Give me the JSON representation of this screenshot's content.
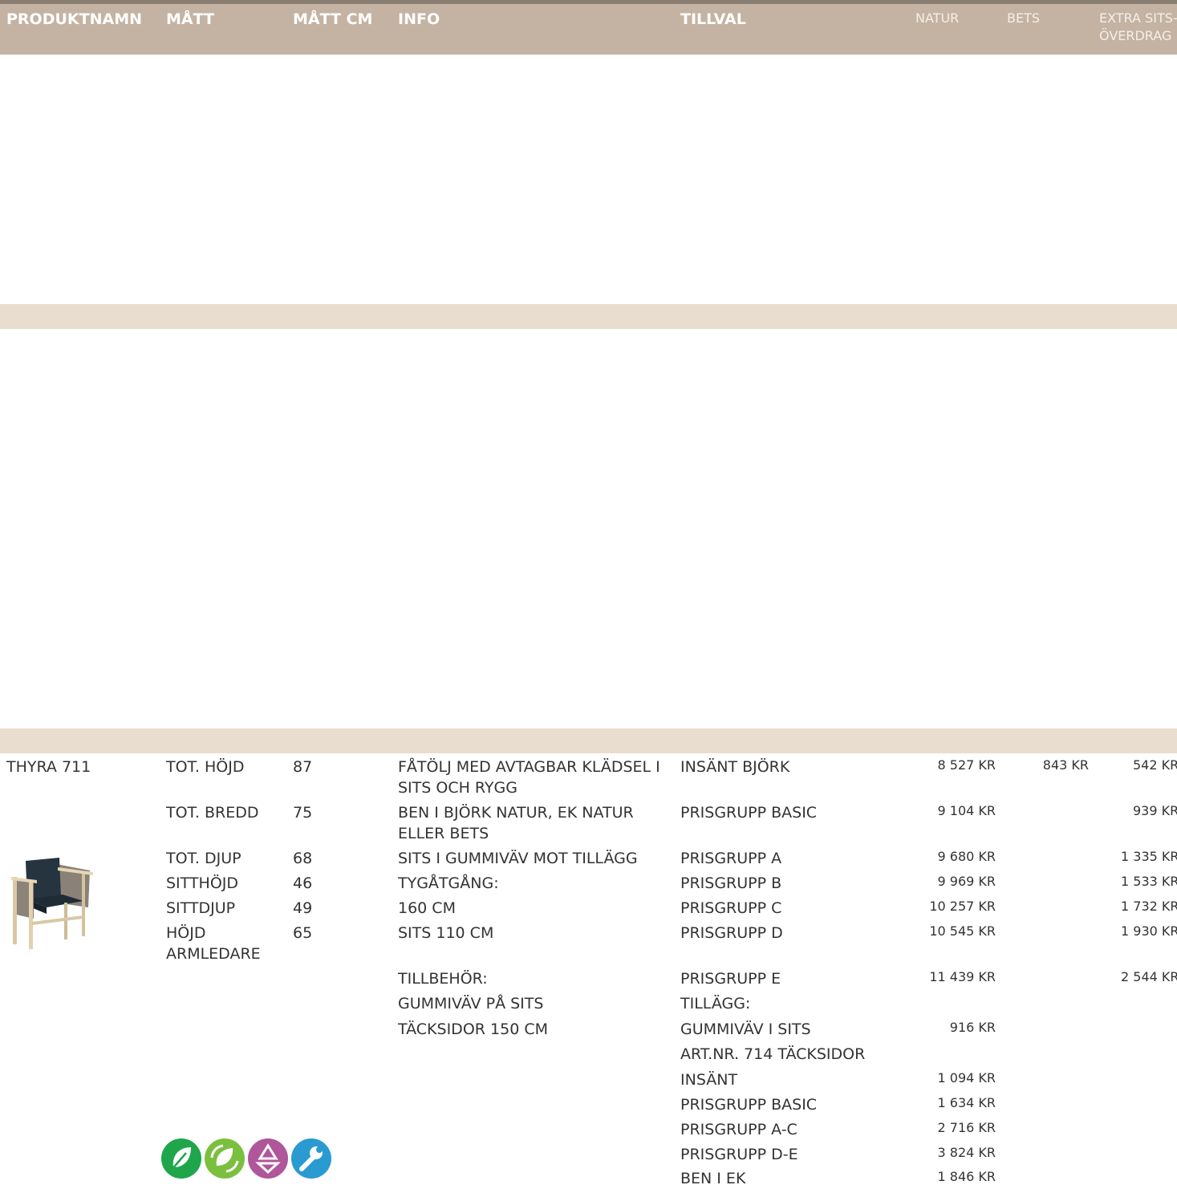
{
  "header": {
    "produktnamn": "PRODUKTNAMN",
    "matt": "MÅTT",
    "matt_cm": "MÅTT CM",
    "info": "INFO",
    "tillval": "TILLVAL",
    "natur": "NATUR",
    "bets": "BETS",
    "extra_line1": "EXTRA SITS-",
    "extra_line2": "ÖVERDRAG"
  },
  "product": {
    "name": "THYRA 711",
    "dims": [
      {
        "label": "TOT. HÖJD",
        "value": "87"
      },
      {
        "label": "TOT. BREDD",
        "value": "75"
      },
      {
        "label": "TOT. DJUP",
        "value": "68"
      },
      {
        "label": "SITTHÖJD",
        "value": "46"
      },
      {
        "label": "SITTDJUP",
        "value": "49"
      },
      {
        "label": "HÖJD",
        "label2": "ARMLEDARE",
        "value": "65"
      }
    ],
    "info": [
      "FÅTÖLJ MED AVTAGBAR KLÄDSEL I",
      "SITS OCH RYGG",
      "BEN I BJÖRK NATUR, EK NATUR",
      "ELLER BETS",
      "SITS  I GUMMIVÄV MOT TILLÄGG",
      "TYGÅTGÅNG:",
      "160 CM",
      "SITS 110 CM",
      "TILLBEHÖR:",
      "GUMMIVÄV PÅ SITS",
      "TÄCKSIDOR  150 CM"
    ],
    "options": [
      {
        "label": "INSÄNT BJÖRK",
        "natur": "8 527 KR",
        "bets": "843 KR",
        "extra": "542 KR"
      },
      {
        "label": "PRISGRUPP BASIC",
        "natur": "9 104 KR",
        "bets": "",
        "extra": "939 KR"
      },
      {
        "label": "PRISGRUPP A",
        "natur": "9 680 KR",
        "bets": "",
        "extra": "1 335 KR"
      },
      {
        "label": "PRISGRUPP B",
        "natur": "9 969 KR",
        "bets": "",
        "extra": "1 533 KR"
      },
      {
        "label": "PRISGRUPP C",
        "natur": "10 257 KR",
        "bets": "",
        "extra": "1 732 KR"
      },
      {
        "label": "PRISGRUPP D",
        "natur": "10 545 KR",
        "bets": "",
        "extra": "1 930 KR"
      },
      {
        "label": "PRISGRUPP E",
        "natur": "11 439 KR",
        "bets": "",
        "extra": "2 544 KR"
      },
      {
        "label": "TILLÄGG:",
        "natur": "",
        "bets": "",
        "extra": ""
      },
      {
        "label": "GUMMIVÄV I SITS",
        "natur": "916 KR",
        "bets": "",
        "extra": ""
      },
      {
        "label": "ART.NR. 714 TÄCKSIDOR",
        "natur": "",
        "bets": "",
        "extra": ""
      },
      {
        "label": "INSÄNT",
        "natur": "1 094 KR",
        "bets": "",
        "extra": ""
      },
      {
        "label": "PRISGRUPP BASIC",
        "natur": "1 634 KR",
        "bets": "",
        "extra": ""
      },
      {
        "label": "PRISGRUPP A-C",
        "natur": "2 716 KR",
        "bets": "",
        "extra": ""
      },
      {
        "label": "PRISGRUPP D-E",
        "natur": "3 824 KR",
        "bets": "",
        "extra": ""
      },
      {
        "label": "BEN I EK",
        "natur": "1 846 KR",
        "bets": "",
        "extra": ""
      }
    ]
  },
  "icons": [
    "leaf-icon",
    "recycled-leaf-icon",
    "recycle-icon",
    "wrench-icon"
  ],
  "colors": {
    "header_bg": "#c4b3a3",
    "band_bg": "#e9ddd0",
    "icon_green": "#1fa64a",
    "icon_lightgreen": "#7bbf3f",
    "icon_purple": "#b0569a",
    "icon_blue": "#2a9bd0"
  }
}
